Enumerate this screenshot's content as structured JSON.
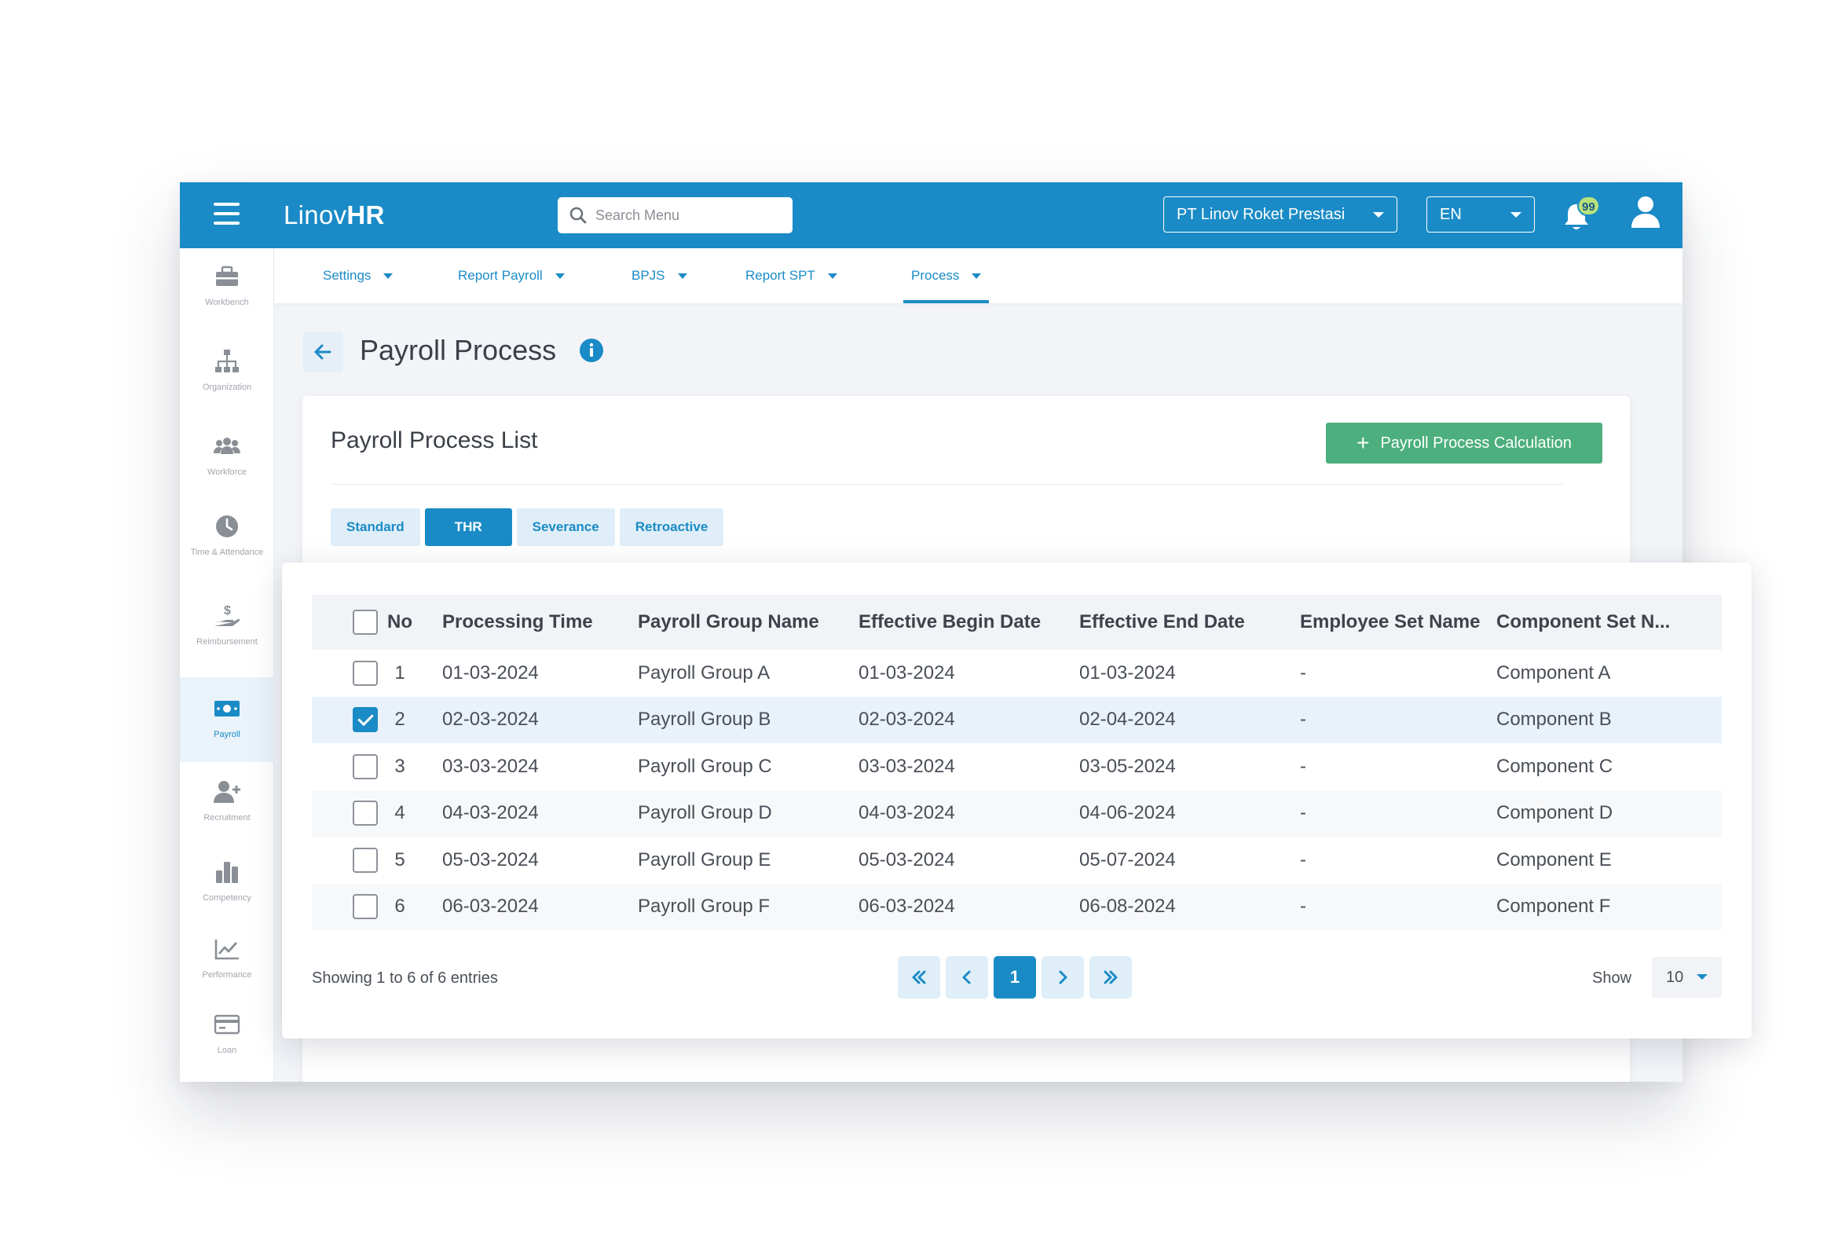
{
  "topbar": {
    "brand_light": "Linov",
    "brand_bold": "HR",
    "search_placeholder": "Search Menu",
    "company": "PT Linov Roket Prestasi",
    "language": "EN",
    "notification_count": "99",
    "accent_color": "#1a8bc6"
  },
  "sidebar": {
    "items": [
      {
        "label": "Workbench",
        "icon": "toolbox-icon"
      },
      {
        "label": "Organization",
        "icon": "org-chart-icon"
      },
      {
        "label": "Workforce",
        "icon": "users-icon"
      },
      {
        "label": "Time & Attendance",
        "icon": "clock-icon"
      },
      {
        "label": "Reimbursement",
        "icon": "hand-money-icon"
      },
      {
        "label": "Payroll",
        "icon": "money-bill-icon"
      },
      {
        "label": "Recruitment",
        "icon": "user-plus-icon"
      },
      {
        "label": "Competency",
        "icon": "bar-chart-icon"
      },
      {
        "label": "Performance",
        "icon": "line-chart-icon"
      },
      {
        "label": "Loan",
        "icon": "credit-card-icon"
      }
    ],
    "active": "Payroll"
  },
  "subnav": {
    "items": [
      "Settings",
      "Report Payroll",
      "BPJS",
      "Report SPT",
      "Process"
    ],
    "active": "Process"
  },
  "page": {
    "title": "Payroll Process"
  },
  "card": {
    "title": "Payroll Process List",
    "calc_button": "Payroll Process Calculation",
    "calc_color": "#4caf7d",
    "tabs": [
      "Standard",
      "THR",
      "Severance",
      "Retroactive"
    ],
    "active_tab": "THR"
  },
  "table": {
    "columns": [
      "No",
      "Processing Time",
      "Payroll Group Name",
      "Effective Begin Date",
      "Effective End Date",
      "Employee Set Name",
      "Component Set N..."
    ],
    "rows": [
      {
        "no": "1",
        "processing_time": "01-03-2024",
        "group": "Payroll Group A",
        "begin": "01-03-2024",
        "end": "01-03-2024",
        "employee_set": "-",
        "component_set": "Component A",
        "checked": false
      },
      {
        "no": "2",
        "processing_time": "02-03-2024",
        "group": "Payroll Group B",
        "begin": "02-03-2024",
        "end": "02-04-2024",
        "employee_set": "-",
        "component_set": "Component B",
        "checked": true
      },
      {
        "no": "3",
        "processing_time": "03-03-2024",
        "group": "Payroll Group C",
        "begin": "03-03-2024",
        "end": "03-05-2024",
        "employee_set": "-",
        "component_set": "Component C",
        "checked": false
      },
      {
        "no": "4",
        "processing_time": "04-03-2024",
        "group": "Payroll Group D",
        "begin": "04-03-2024",
        "end": "04-06-2024",
        "employee_set": "-",
        "component_set": "Component D",
        "checked": false
      },
      {
        "no": "5",
        "processing_time": "05-03-2024",
        "group": "Payroll Group E",
        "begin": "05-03-2024",
        "end": "05-07-2024",
        "employee_set": "-",
        "component_set": "Component E",
        "checked": false
      },
      {
        "no": "6",
        "processing_time": "06-03-2024",
        "group": "Payroll Group F",
        "begin": "06-03-2024",
        "end": "06-08-2024",
        "employee_set": "-",
        "component_set": "Component F",
        "checked": false
      }
    ]
  },
  "footer": {
    "showing": "Showing 1 to 6 of 6 entries",
    "current_page": "1",
    "show_label": "Show",
    "page_size": "10"
  }
}
